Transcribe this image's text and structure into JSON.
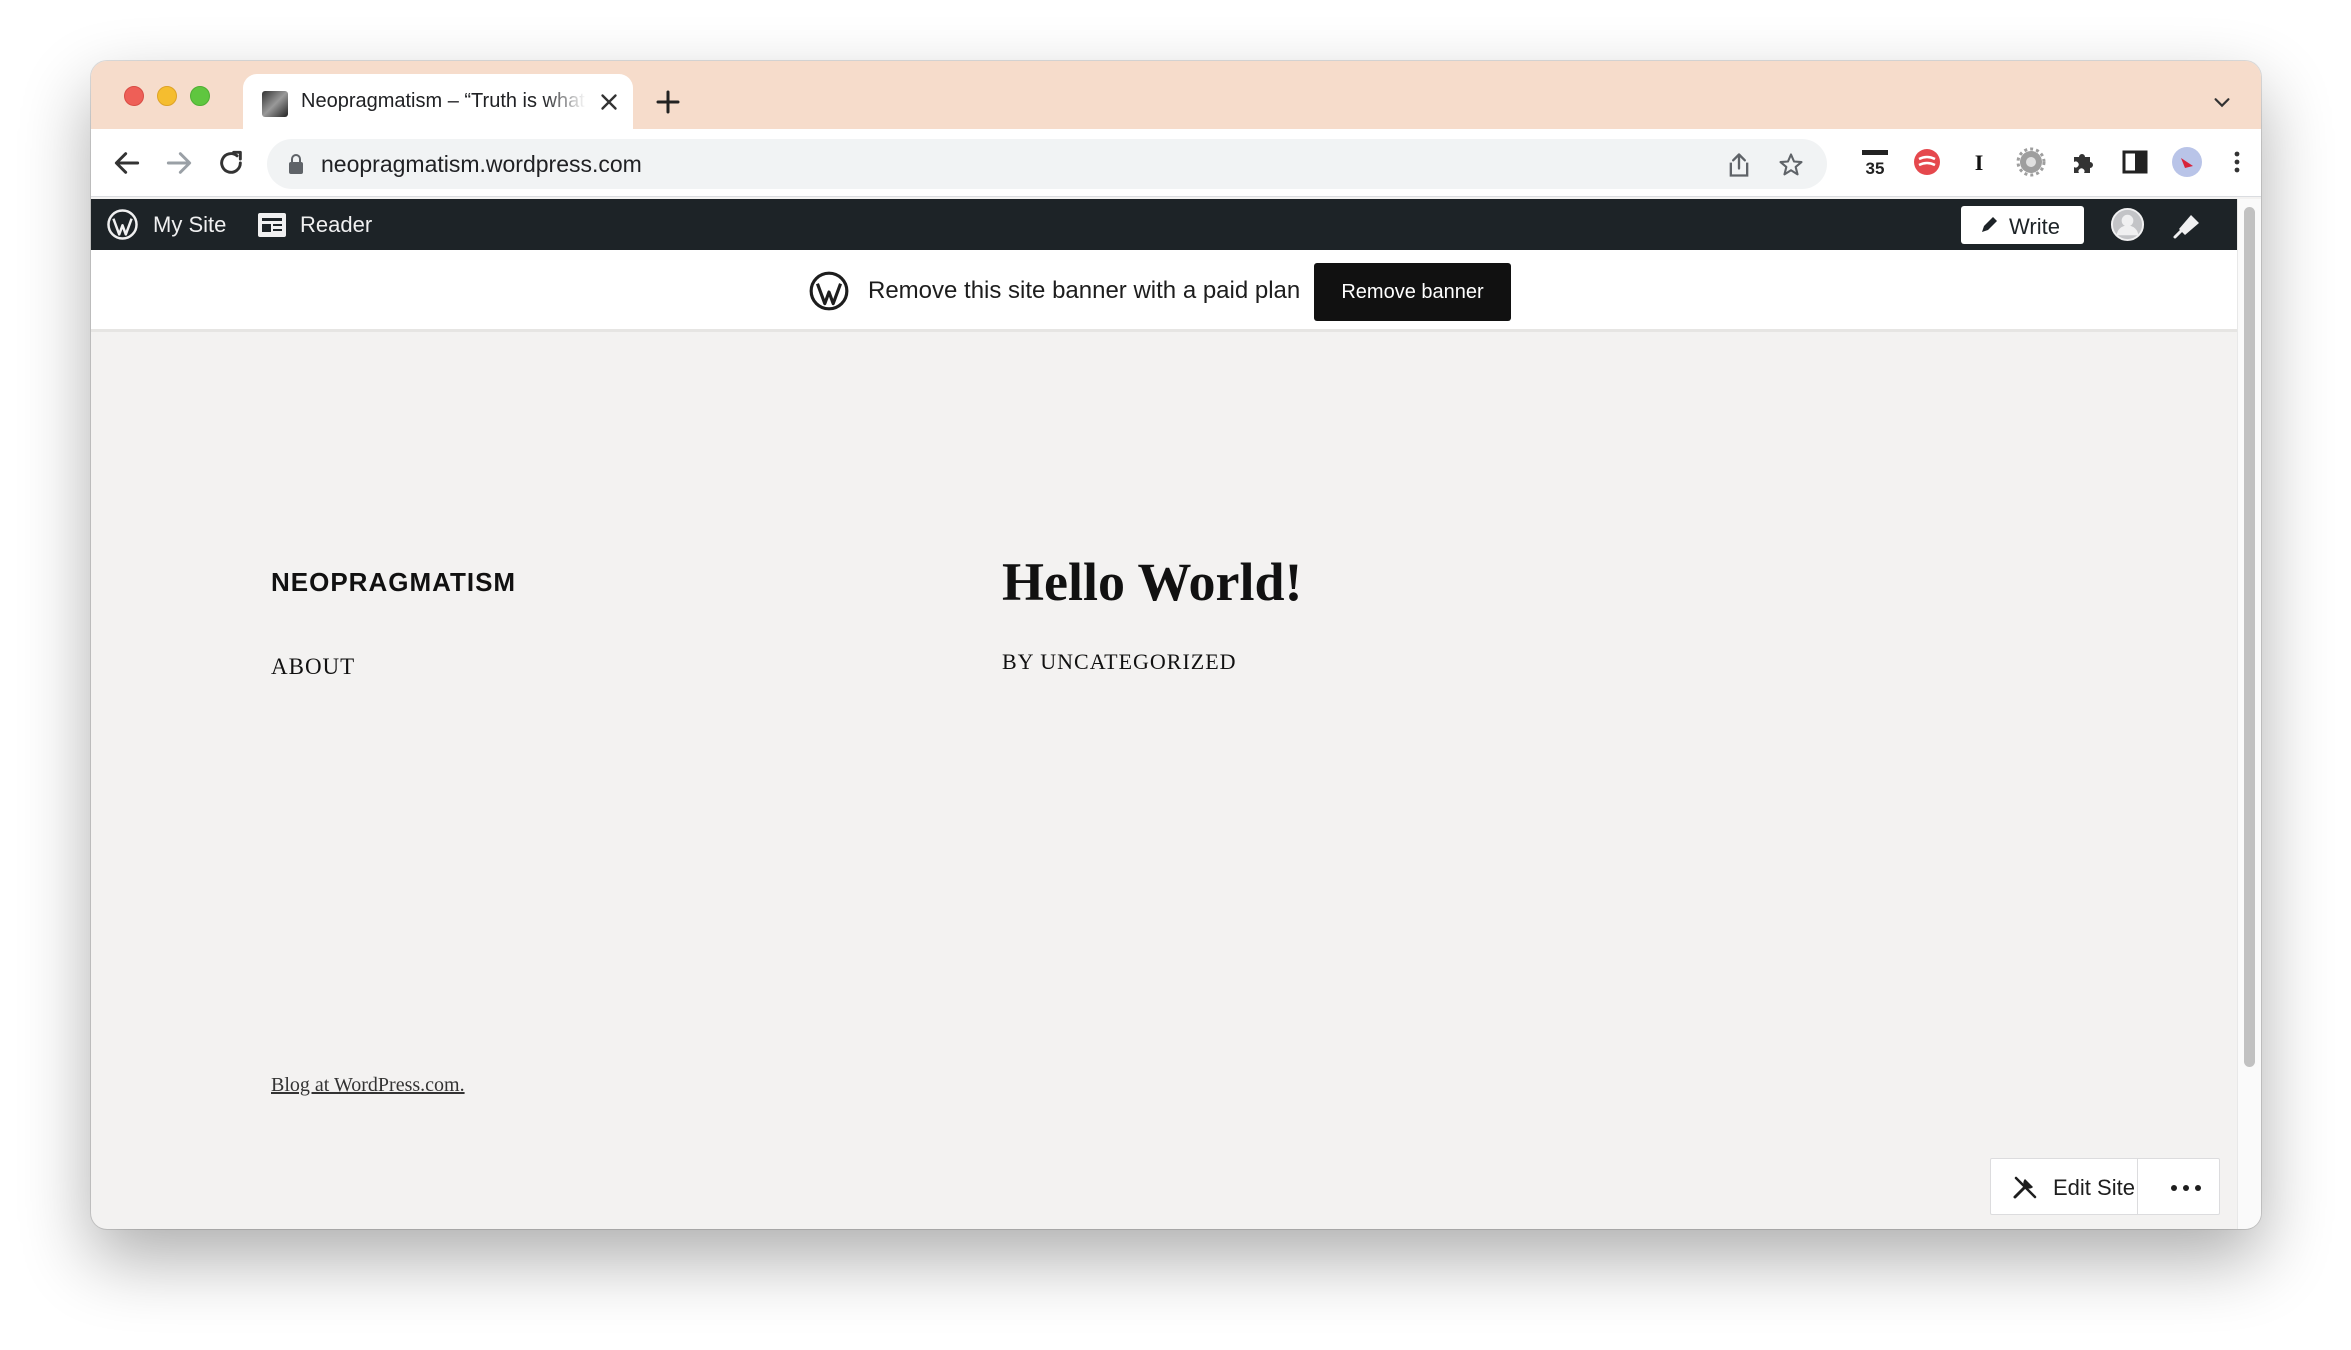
{
  "browser": {
    "tab_title": "Neopragmatism – “Truth is what",
    "url": "neopragmatism.wordpress.com",
    "tab_bar_color": "#f6dccb"
  },
  "admin_bar": {
    "my_site": "My Site",
    "reader": "Reader",
    "write": "Write"
  },
  "banner": {
    "text": "Remove this site banner with a paid plan",
    "button": "Remove banner"
  },
  "site": {
    "title": "NEOPRAGMATISM",
    "nav": [
      "ABOUT"
    ],
    "post_title": "Hello World!",
    "post_meta": "BY UNCATEGORIZED",
    "footer": "Blog at WordPress.com."
  },
  "edit_site": {
    "label": "Edit Site"
  },
  "icons": [
    "wordpress-logo-icon",
    "reader-icon",
    "pencil-icon",
    "avatar-icon",
    "bell-icon",
    "tools-icon",
    "more-icon",
    "share-icon",
    "star-icon",
    "extensions-icon"
  ]
}
